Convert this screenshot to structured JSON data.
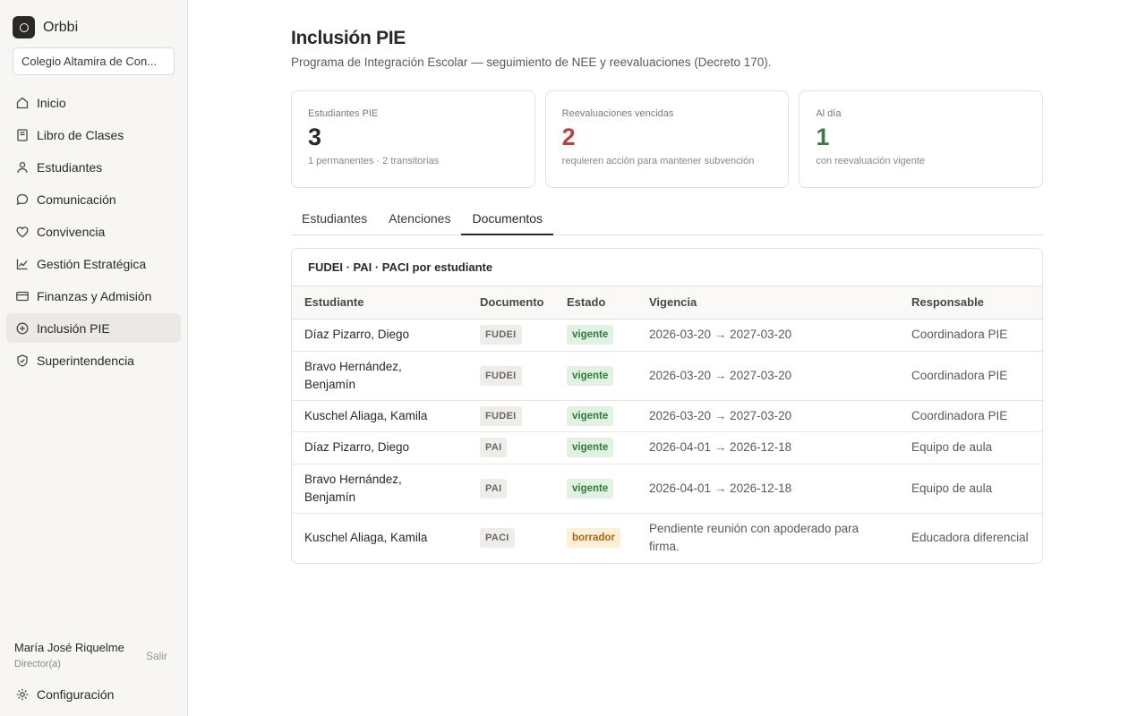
{
  "app": {
    "name": "Orbbi",
    "school": "Colegio Altamira de Con..."
  },
  "nav": [
    {
      "label": "Inicio",
      "icon": "home-icon"
    },
    {
      "label": "Libro de Clases",
      "icon": "book-icon"
    },
    {
      "label": "Estudiantes",
      "icon": "user-icon"
    },
    {
      "label": "Comunicación",
      "icon": "message-icon"
    },
    {
      "label": "Convivencia",
      "icon": "heart-icon"
    },
    {
      "label": "Gestión Estratégica",
      "icon": "chart-line-icon"
    },
    {
      "label": "Finanzas y Admisión",
      "icon": "credit-card-icon"
    },
    {
      "label": "Inclusión PIE",
      "icon": "plus-circle-icon",
      "active": true
    },
    {
      "label": "Superintendencia",
      "icon": "shield-icon"
    }
  ],
  "user": {
    "name": "María José Riquelme",
    "role": "Director(a)",
    "logout": "Salir"
  },
  "config": {
    "label": "Configuración"
  },
  "page": {
    "title": "Inclusión PIE",
    "subtitle": "Programa de Integración Escolar — seguimiento de NEE y reevaluaciones (Decreto 170)."
  },
  "cards": [
    {
      "label": "Estudiantes PIE",
      "value": "3",
      "note": "1 permanentes · 2 transitorias",
      "tone": "neutral"
    },
    {
      "label": "Reevaluaciones vencidas",
      "value": "2",
      "note": "requieren acción para mantener subvención",
      "tone": "red"
    },
    {
      "label": "Al día",
      "value": "1",
      "note": "con reevaluación vigente",
      "tone": "green"
    }
  ],
  "tabs": [
    {
      "label": "Estudiantes"
    },
    {
      "label": "Atenciones"
    },
    {
      "label": "Documentos",
      "active": true
    }
  ],
  "panel": {
    "title": "FUDEI · PAI · PACI por estudiante",
    "columns": [
      "Estudiante",
      "Documento",
      "Estado",
      "Vigencia",
      "Responsable"
    ],
    "rows": [
      {
        "student": "Díaz Pizarro, Diego",
        "doc": "FUDEI",
        "status": "vigente",
        "validity": "2026-03-20 → 2027-03-20",
        "owner": "Coordinadora PIE"
      },
      {
        "student": "Bravo Hernández, Benjamín",
        "doc": "FUDEI",
        "status": "vigente",
        "validity": "2026-03-20 → 2027-03-20",
        "owner": "Coordinadora PIE"
      },
      {
        "student": "Kuschel Aliaga, Kamila",
        "doc": "FUDEI",
        "status": "vigente",
        "validity": "2026-03-20 → 2027-03-20",
        "owner": "Coordinadora PIE"
      },
      {
        "student": "Díaz Pizarro, Diego",
        "doc": "PAI",
        "status": "vigente",
        "validity": "2026-04-01 → 2026-12-18",
        "owner": "Equipo de aula"
      },
      {
        "student": "Bravo Hernández, Benjamín",
        "doc": "PAI",
        "status": "vigente",
        "validity": "2026-04-01 → 2026-12-18",
        "owner": "Equipo de aula"
      },
      {
        "student": "Kuschel Aliaga, Kamila",
        "doc": "PACI",
        "status": "borrador",
        "validity": "Pendiente reunión con apoderado para firma.",
        "owner": "Educadora diferencial"
      }
    ]
  },
  "colors": {
    "accent_dark": "#2b2926",
    "danger": "#b5453a",
    "success": "#3f7a46",
    "vigente_bg": "#e1f1e2",
    "borrador_bg": "#fbf0d6"
  }
}
